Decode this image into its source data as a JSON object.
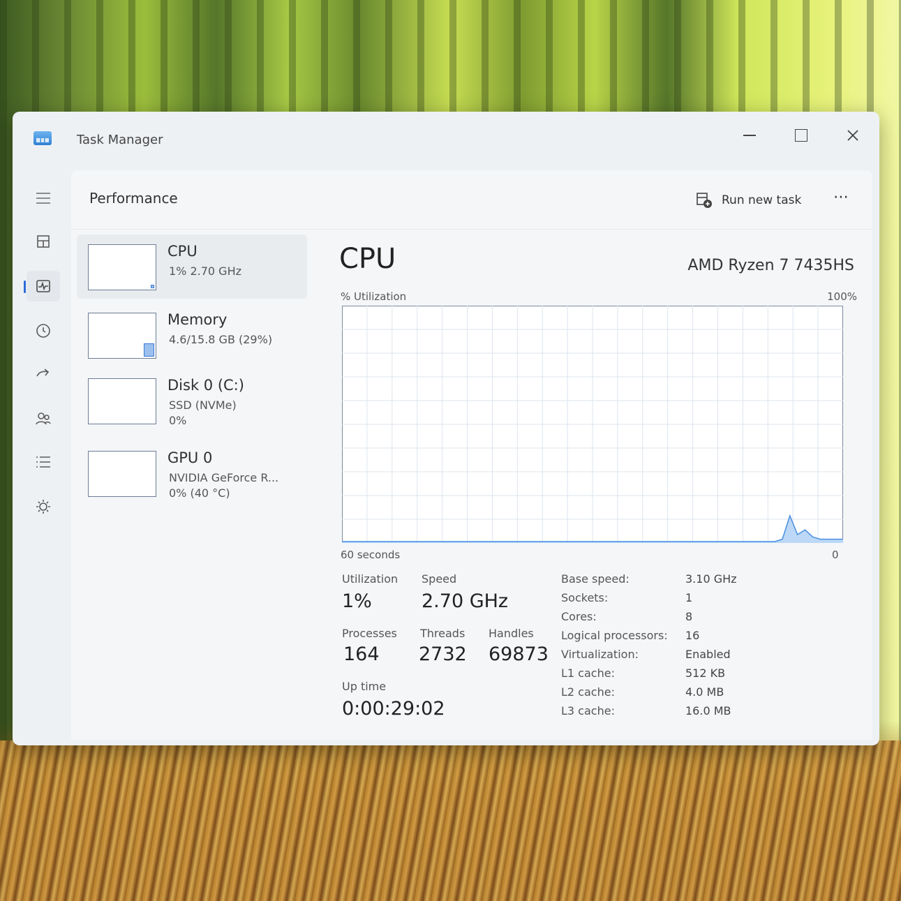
{
  "window": {
    "title": "Task Manager",
    "controls": {
      "minimize": "minimize",
      "maximize": "maximize",
      "close": "close"
    }
  },
  "nav": [
    {
      "name": "hamburger-icon"
    },
    {
      "name": "processes-icon"
    },
    {
      "name": "performance-icon",
      "active": true
    },
    {
      "name": "app-history-icon"
    },
    {
      "name": "startup-apps-icon"
    },
    {
      "name": "users-icon"
    },
    {
      "name": "details-icon"
    },
    {
      "name": "services-icon"
    },
    {
      "name": "settings-icon"
    }
  ],
  "header": {
    "page_title": "Performance",
    "run_new_task": "Run new task",
    "more": "⋯"
  },
  "devices": [
    {
      "name": "CPU",
      "line1": "1%  2.70 GHz",
      "line2": "",
      "fill": 0.01,
      "selected": true
    },
    {
      "name": "Memory",
      "line1": "4.6/15.8 GB (29%)",
      "line2": "",
      "fill": 0.29
    },
    {
      "name": "Disk 0 (C:)",
      "line1": "SSD (NVMe)",
      "line2": "0%",
      "fill": 0
    },
    {
      "name": "GPU 0",
      "line1": "NVIDIA GeForce R...",
      "line2": "0% (40 °C)",
      "fill": 0
    }
  ],
  "cpu": {
    "title": "CPU",
    "model": "AMD Ryzen 7 7435HS",
    "graph_label": "% Utilization",
    "graph_max": "100%",
    "graph_left": "60 seconds",
    "graph_right": "0",
    "stats": {
      "utilization_label": "Utilization",
      "utilization": "1%",
      "speed_label": "Speed",
      "speed": "2.70 GHz",
      "processes_label": "Processes",
      "processes": "164",
      "threads_label": "Threads",
      "threads": "2732",
      "handles_label": "Handles",
      "handles": "69873",
      "uptime_label": "Up time",
      "uptime": "0:00:29:02"
    },
    "specs": [
      {
        "k": "Base speed:",
        "v": "3.10 GHz"
      },
      {
        "k": "Sockets:",
        "v": "1"
      },
      {
        "k": "Cores:",
        "v": "8"
      },
      {
        "k": "Logical processors:",
        "v": "16"
      },
      {
        "k": "Virtualization:",
        "v": "Enabled"
      },
      {
        "k": "L1 cache:",
        "v": "512 KB"
      },
      {
        "k": "L2 cache:",
        "v": "4.0 MB"
      },
      {
        "k": "L3 cache:",
        "v": "16.0 MB"
      }
    ],
    "history": [
      0,
      0,
      0,
      0,
      0,
      0,
      0,
      0,
      0,
      0,
      0,
      0,
      0,
      0,
      0,
      0,
      0,
      0,
      0,
      0,
      0,
      0,
      0,
      0,
      0,
      0,
      0,
      0,
      0,
      0,
      0,
      0,
      0,
      0,
      0,
      0,
      0,
      0,
      0,
      0,
      0,
      0,
      0,
      0,
      0,
      0,
      0,
      0,
      0,
      0,
      0,
      0,
      0,
      0,
      0,
      0,
      0,
      0,
      1,
      11,
      3,
      5,
      2,
      1,
      1,
      1,
      1
    ]
  },
  "colors": {
    "accent": "#2b6cd8",
    "graph_line": "#4a8fe0",
    "graph_fill": "#bcd8f6",
    "grid": "#dde4ee"
  }
}
